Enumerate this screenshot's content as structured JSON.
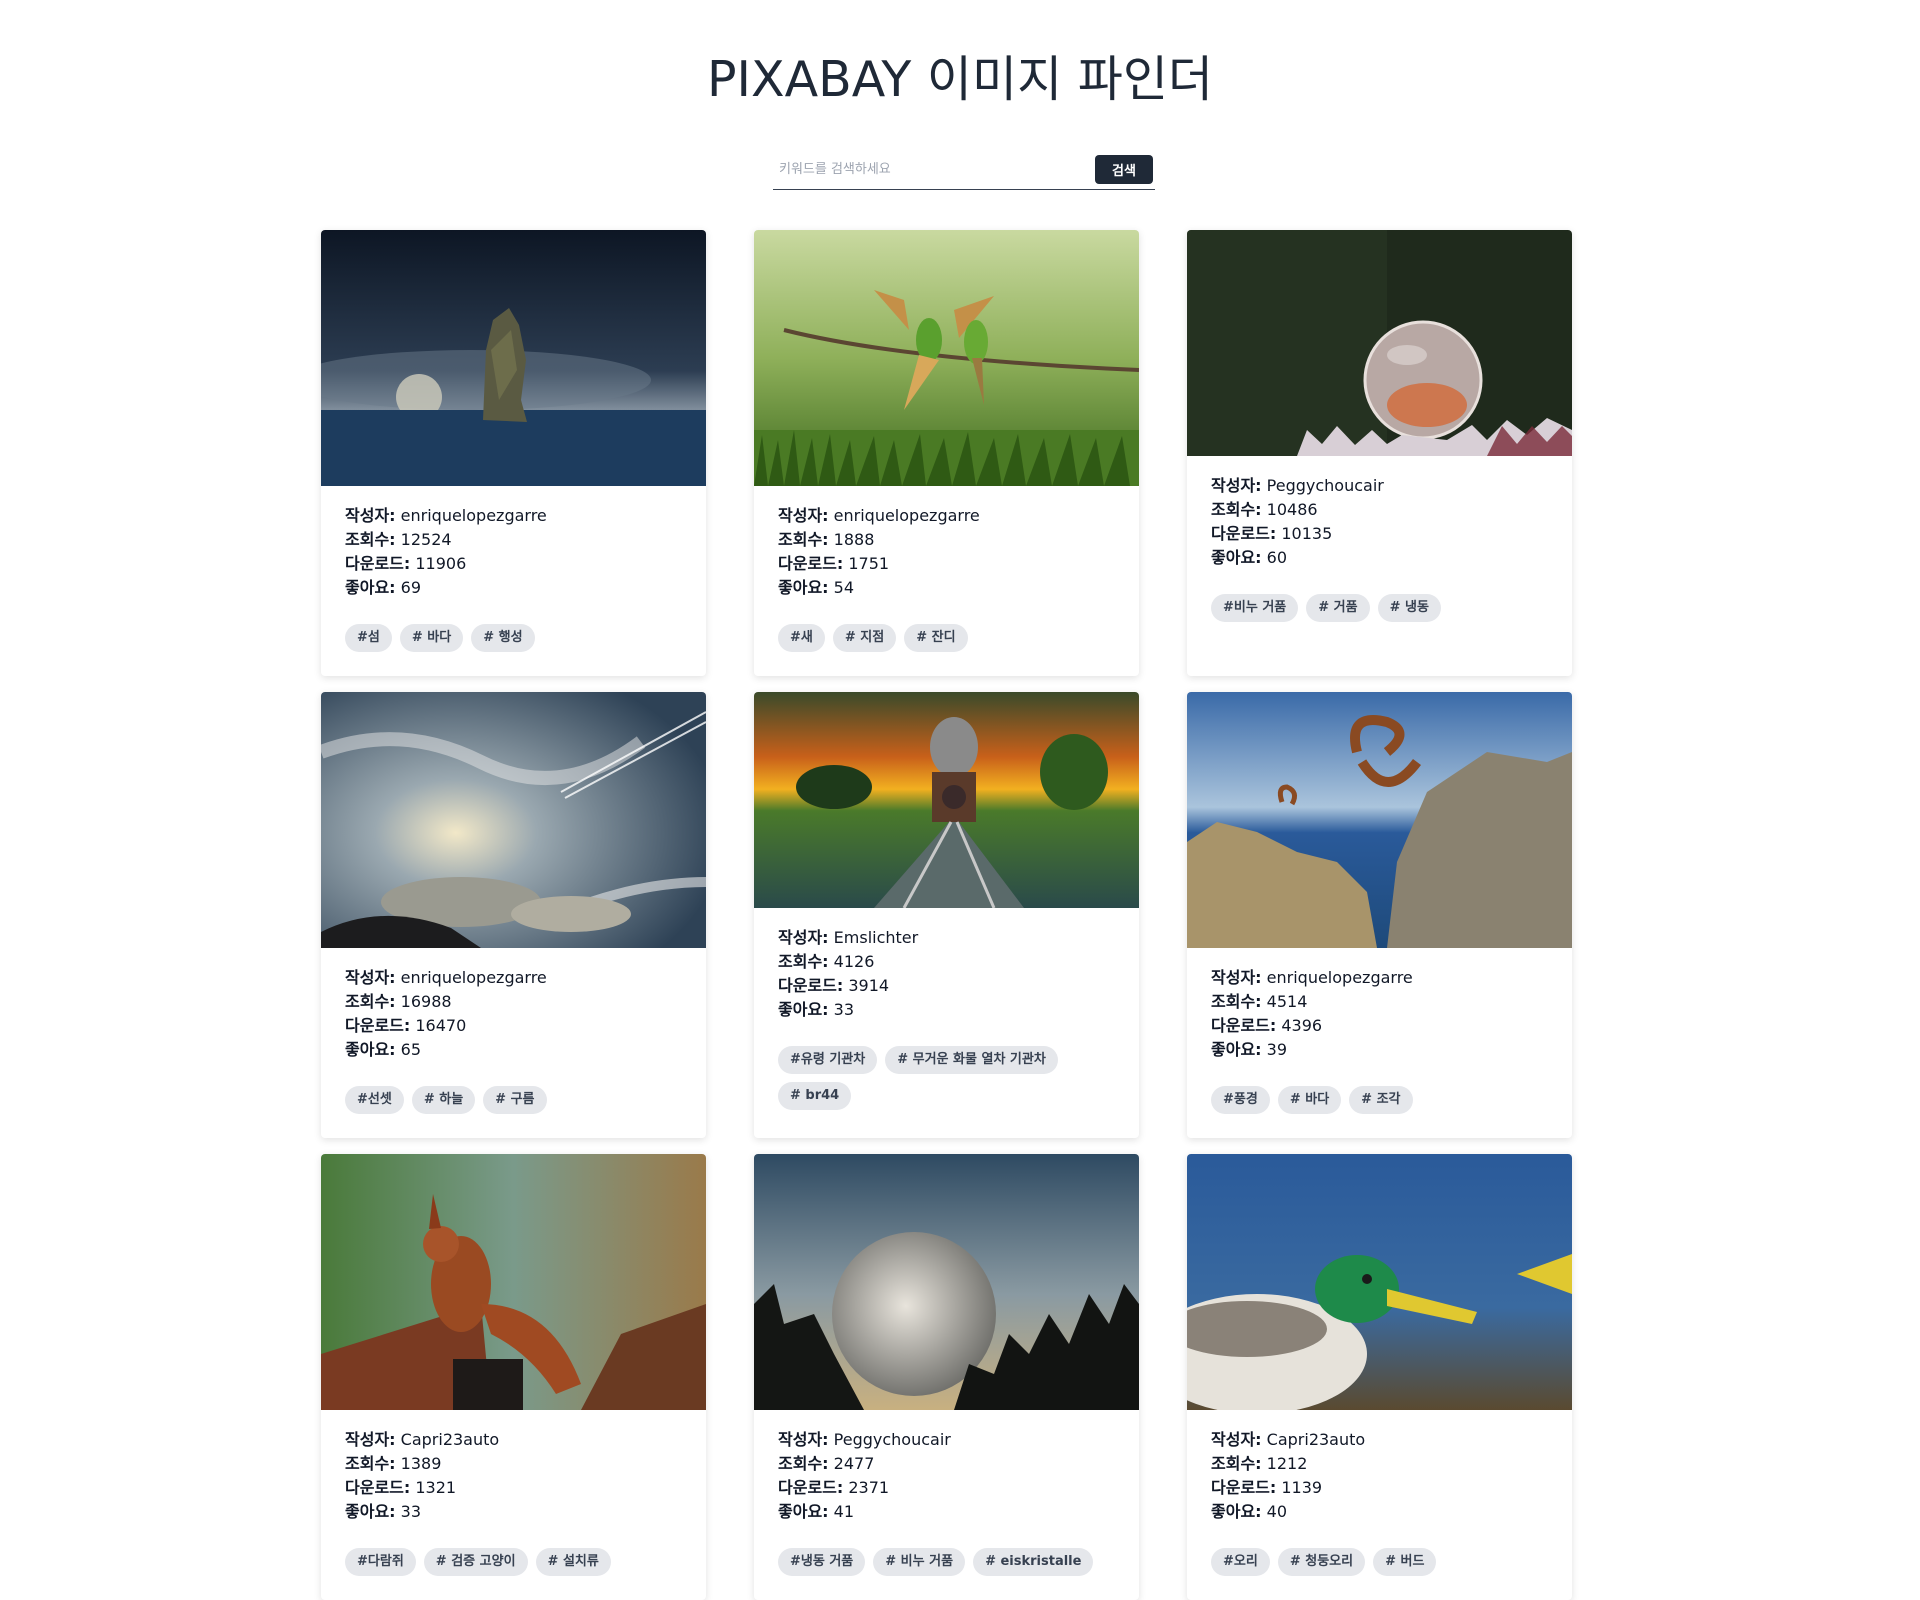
{
  "header": {
    "title": "PIXABAY 이미지 파인더"
  },
  "search": {
    "placeholder": "키워드를 검색하세요",
    "value": "",
    "button_label": "검색"
  },
  "labels": {
    "author": "작성자:",
    "views": "조회수:",
    "downloads": "다운로드:",
    "likes": "좋아요:"
  },
  "cards": [
    {
      "author": "enriquelopezgarre",
      "views": "12524",
      "downloads": "11906",
      "likes": "69",
      "tags": [
        "#섬",
        "# 바다",
        "# 행성"
      ]
    },
    {
      "author": "enriquelopezgarre",
      "views": "1888",
      "downloads": "1751",
      "likes": "54",
      "tags": [
        "#새",
        "# 지점",
        "# 잔디"
      ]
    },
    {
      "author": "Peggychoucair",
      "views": "10486",
      "downloads": "10135",
      "likes": "60",
      "tags": [
        "#비누 거품",
        "# 거품",
        "# 냉동"
      ]
    },
    {
      "author": "enriquelopezgarre",
      "views": "16988",
      "downloads": "16470",
      "likes": "65",
      "tags": [
        "#선셋",
        "# 하늘",
        "# 구름"
      ]
    },
    {
      "author": "Emslichter",
      "views": "4126",
      "downloads": "3914",
      "likes": "33",
      "tags": [
        "#유령 기관차",
        "# 무거운 화물 열차 기관차",
        "# br44"
      ]
    },
    {
      "author": "enriquelopezgarre",
      "views": "4514",
      "downloads": "4396",
      "likes": "39",
      "tags": [
        "#풍경",
        "# 바다",
        "# 조각"
      ]
    },
    {
      "author": "Capri23auto",
      "views": "1389",
      "downloads": "1321",
      "likes": "33",
      "tags": [
        "#다람쥐",
        "# 검증 고양이",
        "# 설치류"
      ]
    },
    {
      "author": "Peggychoucair",
      "views": "2477",
      "downloads": "2371",
      "likes": "41",
      "tags": [
        "#냉동 거품",
        "# 비누 거품",
        "# eiskristalle"
      ]
    },
    {
      "author": "Capri23auto",
      "views": "1212",
      "downloads": "1139",
      "likes": "40",
      "tags": [
        "#오리",
        "# 청둥오리",
        "# 버드"
      ]
    }
  ]
}
